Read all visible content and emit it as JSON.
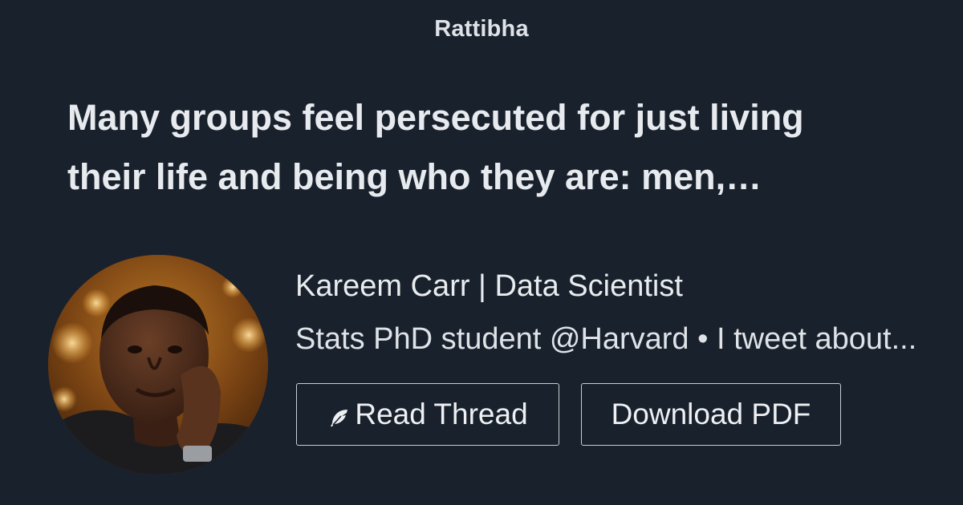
{
  "brand": {
    "name": "Rattibha"
  },
  "headline": {
    "line1": "Many groups feel persecuted for just living",
    "line2": "their life and being who they are: men,…"
  },
  "author": {
    "name": "Kareem Carr | Data Scientist",
    "bio": "Stats PhD student @Harvard • I tweet about..."
  },
  "buttons": {
    "read_thread": "Read Thread",
    "download_pdf": "Download PDF"
  },
  "icons": {
    "read_thread_icon": "feather-icon"
  },
  "colors": {
    "background": "#19212c",
    "text": "#e9ecef",
    "button_border": "#c9ced4"
  }
}
